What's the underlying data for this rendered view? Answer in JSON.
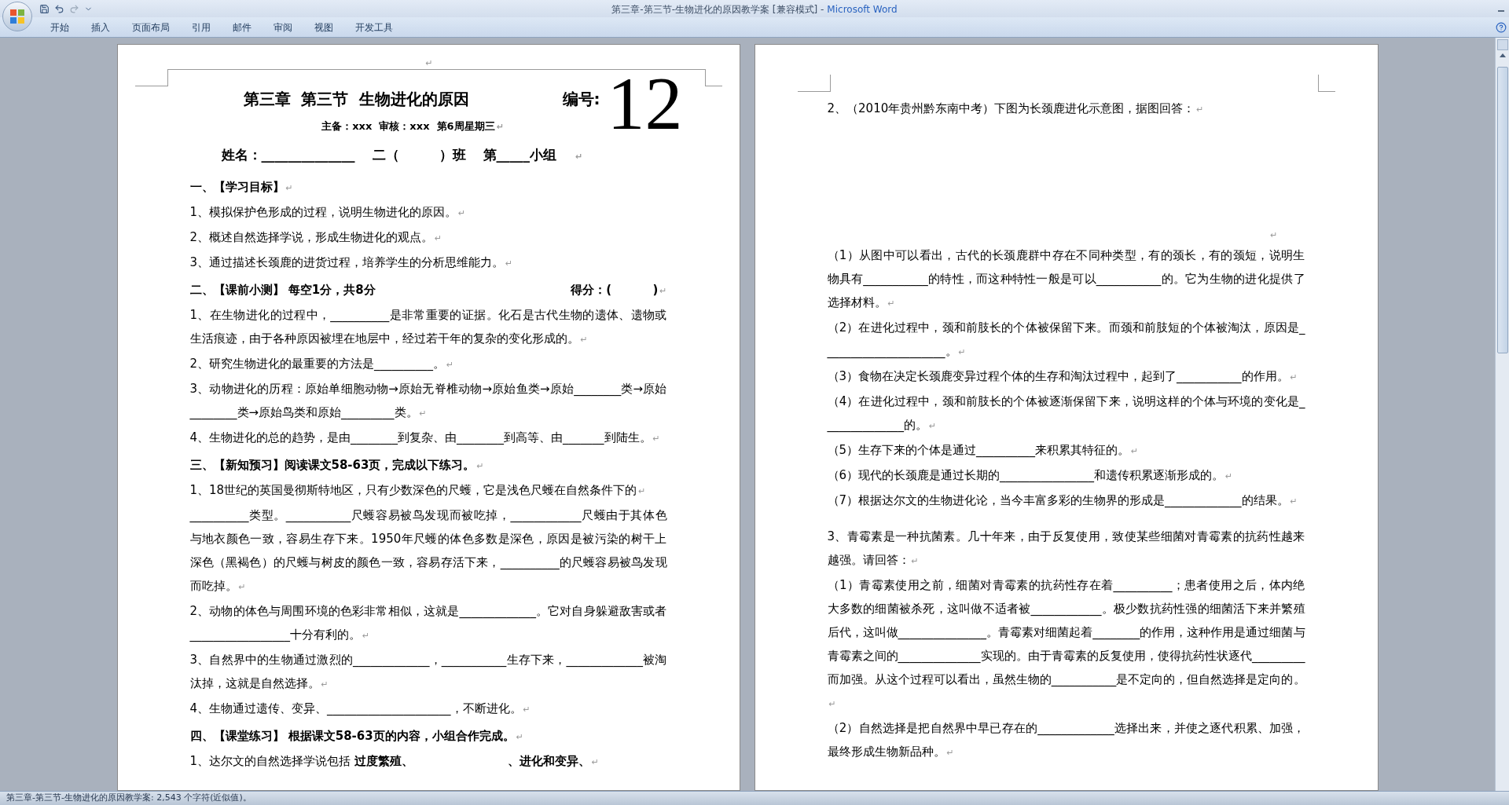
{
  "window": {
    "title": "第三章-第三节-生物进化的原因教学案 [兼容模式] -",
    "app": "Microsoft Word"
  },
  "ribbon_tabs": [
    {
      "label": "开始"
    },
    {
      "label": "插入"
    },
    {
      "label": "页面布局"
    },
    {
      "label": "引用"
    },
    {
      "label": "邮件"
    },
    {
      "label": "审阅"
    },
    {
      "label": "视图"
    },
    {
      "label": "开发工具"
    }
  ],
  "left_page": {
    "header_mark": "↵",
    "title": "第三章  第三节  生物进化的原因",
    "number_label": "编号:",
    "number": "12",
    "authors": "主备：xxx  审核：xxx  第6周星期三",
    "authors_mark": "↵",
    "name_line": [
      "姓名：______________",
      "二（　　　）班",
      "第_____小组"
    ],
    "name_mark": "↵",
    "paragraphs": [
      {
        "kind": "heading",
        "text": "一、【学习目标】",
        "mark": "↵"
      },
      {
        "kind": "item",
        "text": "1、模拟保护色形成的过程，说明生物进化的原因。",
        "mark": "↵"
      },
      {
        "kind": "item",
        "text": "2、概述自然选择学说，形成生物进化的观点。",
        "mark": "↵"
      },
      {
        "kind": "item",
        "text": "3、通过描述长颈鹿的进货过程，培养学生的分析思维能力。",
        "mark": "↵"
      },
      {
        "kind": "heading",
        "text": "二、【课前小测】 每空1分，共8分",
        "right": "得分：(          )",
        "mark": "↵"
      },
      {
        "kind": "item",
        "text": "1、在生物进化的过程中，__________是非常重要的证据。化石是古代生物的遗体、遗物或生活痕迹，由于各种原因被埋在地层中，经过若干年的复杂的变化形成的。",
        "mark": "↵"
      },
      {
        "kind": "item",
        "text": "2、研究生物进化的最重要的方法是__________。",
        "mark": "↵"
      },
      {
        "kind": "item",
        "text": "3、动物进化的历程：原始单细胞动物→原始无脊椎动物→原始鱼类→原始________类→原始________类→原始鸟类和原始_________类。",
        "mark": "↵"
      },
      {
        "kind": "item",
        "text": "4、生物进化的总的趋势，是由________到复杂、由________到高等、由_______到陆生。",
        "mark": "↵"
      },
      {
        "kind": "heading",
        "text": "三、【新知预习】阅读课文58-63页，完成以下练习。",
        "mark": "↵"
      },
      {
        "kind": "item",
        "text": "1、18世纪的英国曼彻斯特地区，只有少数深色的尺蠖，它是浅色尺蠖在自然条件下的",
        "mark": "↵"
      },
      {
        "kind": "item",
        "text": "__________类型。___________尺蠖容易被鸟发现而被吃掉，____________尺蠖由于其体色与地衣颜色一致，容易生存下来。1950年尺蠖的体色多数是深色，原因是被污染的树干上深色（黑褐色）的尺蠖与树皮的颜色一致，容易存活下来，__________的尺蠖容易被鸟发现而吃掉。",
        "mark": "↵"
      },
      {
        "kind": "item",
        "text": "2、动物的体色与周围环境的色彩非常相似，这就是_____________。它对自身躲避敌害或者_________________十分有利的。",
        "mark": "↵"
      },
      {
        "kind": "item",
        "text": "3、自然界中的生物通过激烈的_____________，___________生存下来，_____________被淘汰掉，这就是自然选择。",
        "mark": "↵"
      },
      {
        "kind": "item",
        "text": "4、生物通过遗传、变异、_____________________，不断进化。",
        "mark": "↵"
      },
      {
        "kind": "heading",
        "text": "四、【课堂练习】 根据课文58-63页的内容，小组合作完成。",
        "mark": "↵"
      },
      {
        "kind": "item",
        "text": "1、达尔文的自然选择学说包括 **过度繁殖、**　　　　　　　　**、进化和变异、**",
        "mark": "↵"
      }
    ]
  },
  "right_page": {
    "paragraphs": [
      {
        "kind": "item",
        "text": "2、（2010年贵州黔东南中考）下图为长颈鹿进化示意图，据图回答：",
        "mark": "↵"
      },
      {
        "kind": "space",
        "mark": "↵"
      },
      {
        "kind": "item",
        "text": "（1）从图中可以看出，古代的长颈鹿群中存在不同种类型，有的颈长，有的颈短，说明生物具有___________的特性，而这种特性一般是可以___________的。它为生物的进化提供了选择材料。",
        "mark": "↵"
      },
      {
        "kind": "item",
        "text": "（2）在进化过程中，颈和前肢长的个体被保留下来。而颈和前肢短的个体被淘汰，原因是_____________________。",
        "mark": "↵"
      },
      {
        "kind": "item",
        "text": "（3）食物在决定长颈鹿变异过程个体的生存和淘汰过程中，起到了___________的作用。",
        "mark": "↵"
      },
      {
        "kind": "item",
        "text": "（4）在进化过程中，颈和前肢长的个体被逐渐保留下来，说明这样的个体与环境的变化是______________的。",
        "mark": "↵"
      },
      {
        "kind": "item",
        "text": "（5）生存下来的个体是通过__________来积累其特征的。",
        "mark": "↵"
      },
      {
        "kind": "item",
        "text": "（6）现代的长颈鹿是通过长期的________________和遗传积累逐渐形成的。",
        "mark": "↵"
      },
      {
        "kind": "item",
        "text": "（7）根据达尔文的生物进化论，当今丰富多彩的生物界的形成是_____________的结果。",
        "mark": "↵"
      },
      {
        "kind": "question",
        "text": "3、青霉素是一种抗菌素。几十年来，由于反复使用，致使某些细菌对青霉素的抗药性越来越强。请回答：",
        "mark": "↵"
      },
      {
        "kind": "item",
        "text": "（1）青霉素使用之前，细菌对青霉素的抗药性存在着__________；患者使用之后，体内绝大多数的细菌被杀死，这叫做不适者被____________。极少数抗药性强的细菌活下来并繁殖后代，这叫做_______________。青霉素对细菌起着________的作用，这种作用是通过细菌与青霉素之间的______________实现的。由于青霉素的反复使用，使得抗药性状逐代_________而加强。从这个过程可以看出，虽然生物的___________是不定向的，但自然选择是定向的。",
        "mark": "↵"
      },
      {
        "kind": "item",
        "text": "（2）自然选择是把自然界中早已存在的_____________选择出来，并使之逐代积累、加强，最终形成生物新品种。",
        "mark": "↵"
      }
    ]
  },
  "status_bar": {
    "text": "第三章-第三节-生物进化的原因教学案: 2,543 个字符(近似值)。"
  }
}
